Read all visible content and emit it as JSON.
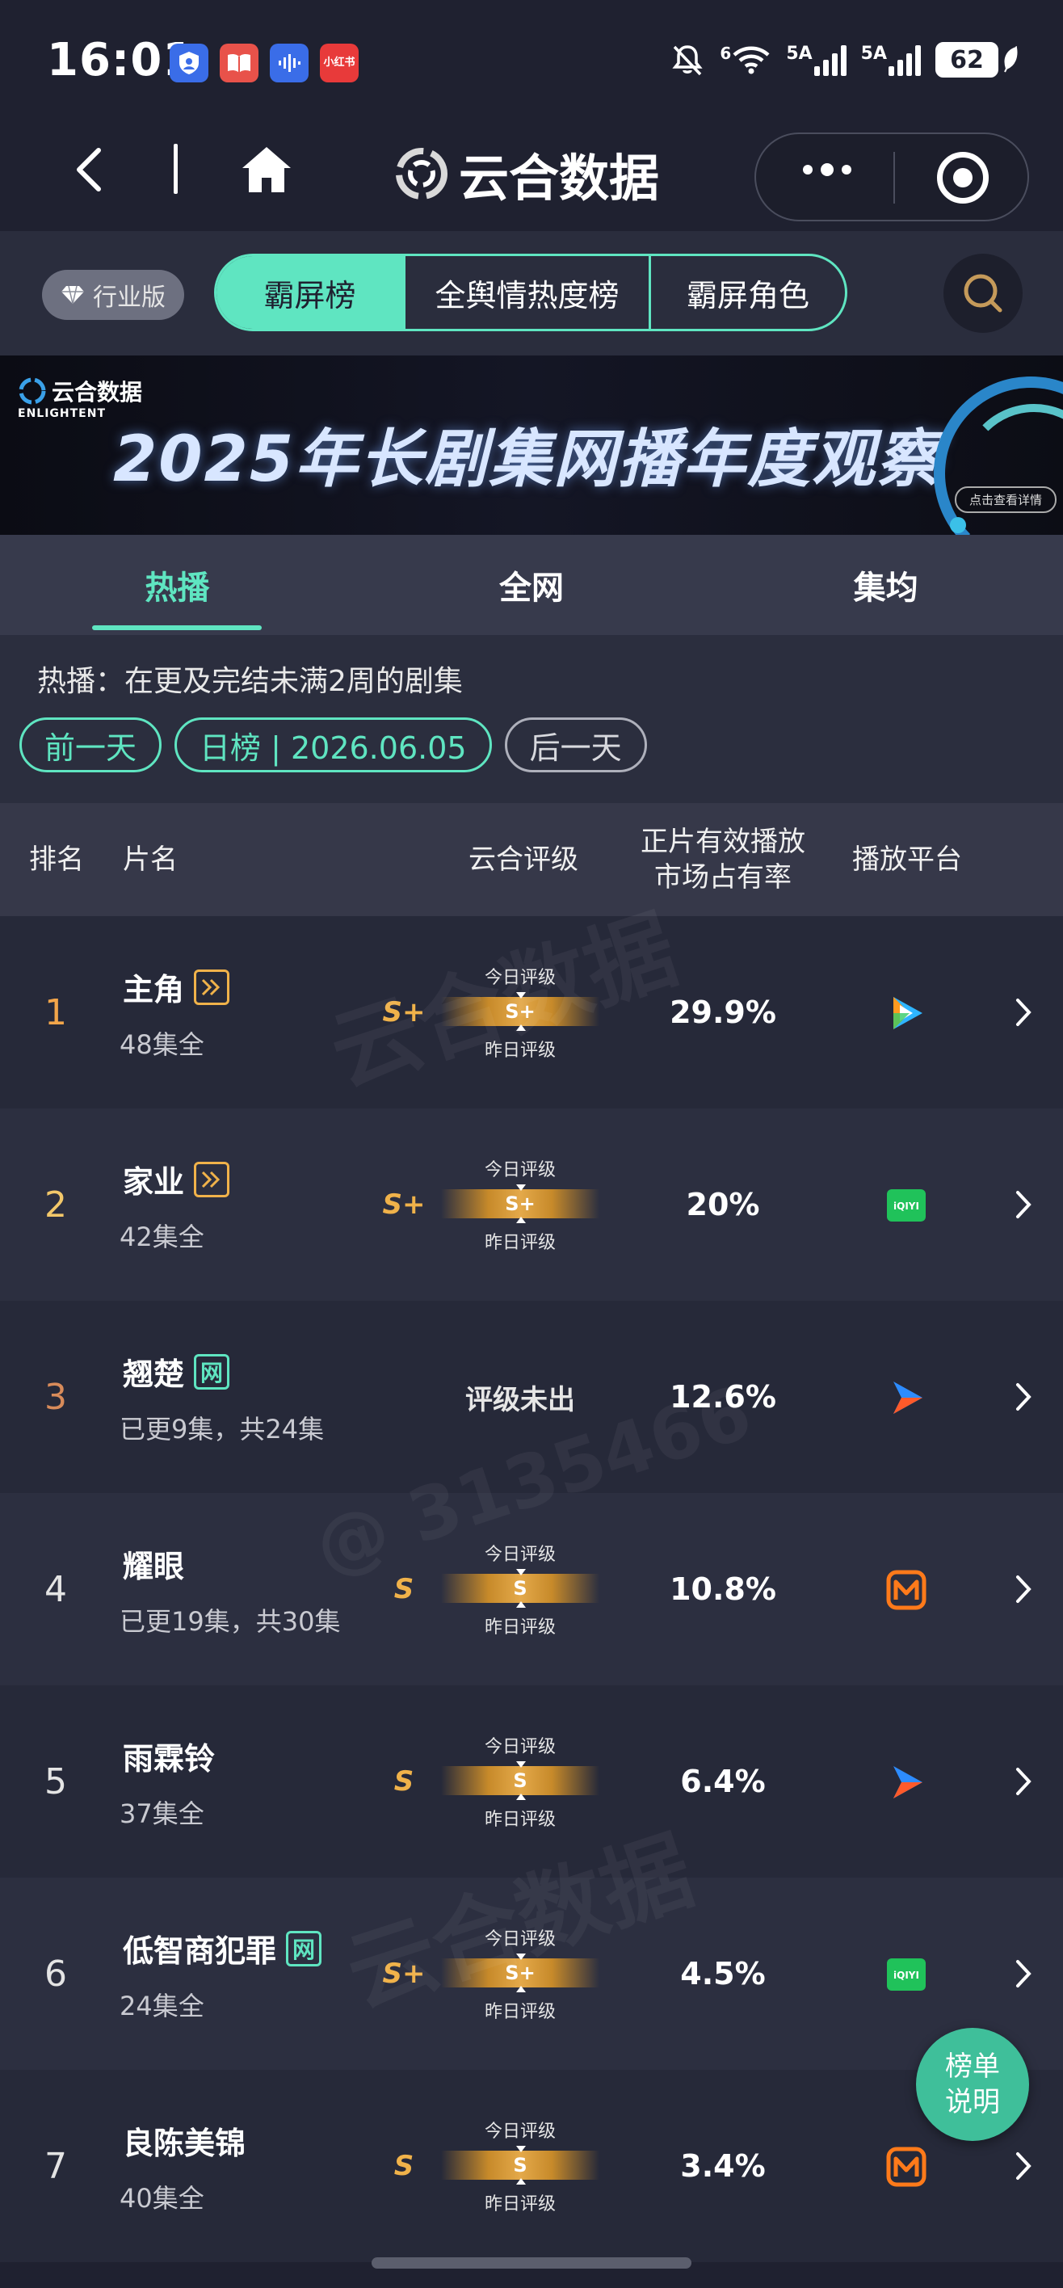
{
  "status_bar": {
    "time": "16:01",
    "battery": "62",
    "network_left": "6",
    "sim1": "5A",
    "sim2": "5A",
    "app_icons": [
      "shield-app-icon",
      "book-app-icon",
      "voice-app-icon",
      "xiaohongshu-app-icon"
    ],
    "xhs_label": "小红书"
  },
  "nav": {
    "title": "云合数据"
  },
  "top_tabs": {
    "industry_badge": "行业版",
    "items": [
      {
        "label": "霸屏榜",
        "active": true
      },
      {
        "label": "全舆情热度榜",
        "active": false
      },
      {
        "label": "霸屏角色",
        "active": false
      }
    ]
  },
  "banner": {
    "logo_main": "云合数据",
    "logo_sub": "ENLIGHTENT",
    "title": "2025年长剧集网播年度观察",
    "chip": "点击查看详情"
  },
  "sub_tabs": [
    {
      "label": "热播",
      "active": true
    },
    {
      "label": "全网",
      "active": false
    },
    {
      "label": "集均",
      "active": false
    }
  ],
  "filter": {
    "description": "热播：在更及完结未满2周的剧集",
    "prev_day": "前一天",
    "current": "日榜 | 2026.06.05",
    "next_day": "后一天"
  },
  "table": {
    "headers": {
      "rank": "排名",
      "title": "片名",
      "grade": "云合评级",
      "share_line1": "正片有效播放",
      "share_line2": "市场占有率",
      "platform": "播放平台"
    },
    "grade_labels": {
      "today": "今日评级",
      "yesterday": "昨日评级"
    },
    "rows": [
      {
        "rank": "1",
        "title": "主角",
        "tag": "play",
        "episodes": "48集全",
        "grade": "S+",
        "grade_mid": "S+",
        "share": "29.9%",
        "platform": "tencent"
      },
      {
        "rank": "2",
        "title": "家业",
        "tag": "play",
        "episodes": "42集全",
        "grade": "S+",
        "grade_mid": "S+",
        "share": "20%",
        "platform": "iqiyi"
      },
      {
        "rank": "3",
        "title": "翘楚",
        "tag": "net",
        "episodes": "已更9集，共24集",
        "grade": "",
        "no_grade": "评级未出",
        "share": "12.6%",
        "platform": "youku"
      },
      {
        "rank": "4",
        "title": "耀眼",
        "tag": "",
        "episodes": "已更19集，共30集",
        "grade": "S",
        "grade_mid": "S",
        "share": "10.8%",
        "platform": "mango"
      },
      {
        "rank": "5",
        "title": "雨霖铃",
        "tag": "",
        "episodes": "37集全",
        "grade": "S",
        "grade_mid": "S",
        "share": "6.4%",
        "platform": "youku"
      },
      {
        "rank": "6",
        "title": "低智商犯罪",
        "tag": "net",
        "episodes": "24集全",
        "grade": "S+",
        "grade_mid": "S+",
        "share": "4.5%",
        "platform": "iqiyi"
      },
      {
        "rank": "7",
        "title": "良陈美锦",
        "tag": "",
        "episodes": "40集全",
        "grade": "S",
        "grade_mid": "S",
        "share": "3.4%",
        "platform": "mango"
      }
    ],
    "net_tag_char": "网"
  },
  "watermark": {
    "brand": "云合数据",
    "brand_sub": "ENLIGHTENT",
    "handle": "@ 3135466"
  },
  "float_help": {
    "line1": "榜单",
    "line2": "说明"
  },
  "colors": {
    "accent": "#5fe5c1",
    "gold": "#f0b24a",
    "bg": "#1f2130"
  }
}
